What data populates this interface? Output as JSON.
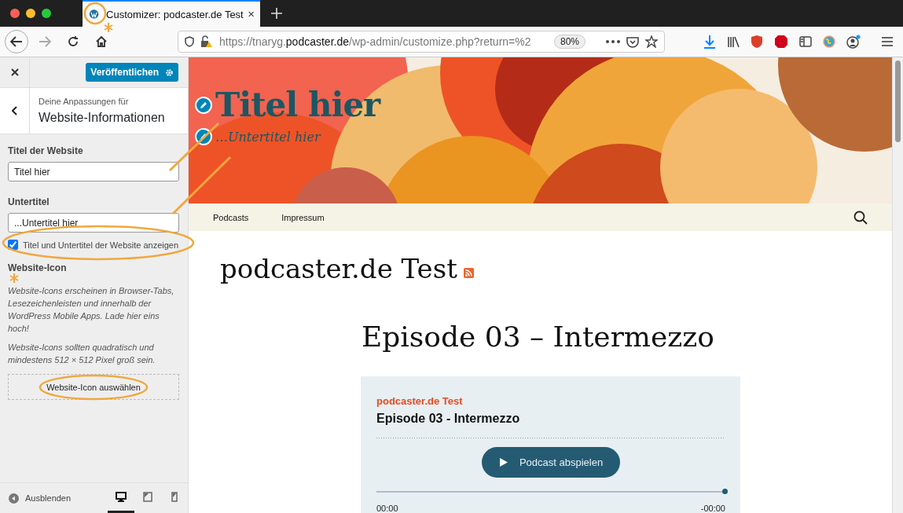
{
  "browser": {
    "tab": {
      "title": "Customizer: podcaster.de Test"
    },
    "address": {
      "prefix": "https://tnaryg.",
      "domain": "podcaster.de",
      "suffix": "/wp-admin/customize.php?return=%2",
      "zoom": "80%"
    }
  },
  "customizer": {
    "publish_button": "Veröffentlichen",
    "section_caption": "Deine Anpassungen für",
    "section_title": "Website-Informationen",
    "fields": [
      {
        "label": "Titel der Website",
        "value": "Titel hier"
      },
      {
        "label": "Untertitel",
        "value": "...Untertitel hier"
      }
    ],
    "checkbox": {
      "label": "Titel und Untertitel der Website anzeigen",
      "checked": true
    },
    "icon_section": {
      "heading": "Website-Icon",
      "paragraphs": [
        "Website-Icons erscheinen in Browser-Tabs, Lesezeichenleisten und innerhalb der WordPress Mobile Apps. Lade hier eins hoch!",
        "Website-Icons sollten quadratisch und mindestens 512 × 512 Pixel groß sein."
      ],
      "button": "Website-Icon auswählen"
    },
    "footer": {
      "hide_label": "Ausblenden",
      "devices": [
        {
          "kind": "desktop",
          "selected": true
        },
        {
          "kind": "tablet",
          "selected": false
        },
        {
          "kind": "mobile",
          "selected": false
        }
      ]
    }
  },
  "preview": {
    "site_title": "Titel hier",
    "tagline": "…Untertitel hier",
    "nav": [
      "Podcasts",
      "Impressum"
    ],
    "blog_title": "podcaster.de Test",
    "post_title": "Episode 03 – Intermezzo",
    "player": {
      "show": "podcaster.de Test",
      "episode": "Episode 03 - Intermezzo",
      "button": "Podcast abspielen",
      "level": 1,
      "time_start": "00:00",
      "time_end": "-00:00"
    }
  }
}
